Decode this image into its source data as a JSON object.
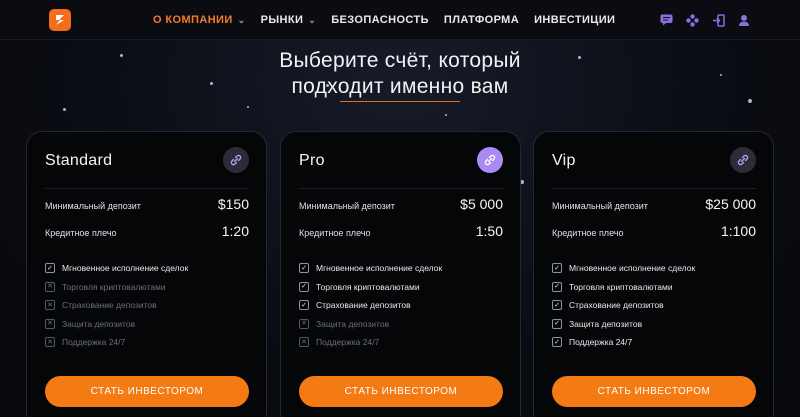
{
  "header": {
    "nav": [
      {
        "label": "О КОМПАНИИ",
        "active": true
      },
      {
        "label": "РЫНКИ",
        "active": false
      },
      {
        "label": "БЕЗОПАСНОСТЬ",
        "active": false
      },
      {
        "label": "ПЛАТФОРМА",
        "active": false
      },
      {
        "label": "ИНВЕСТИЦИИ",
        "active": false
      }
    ],
    "icons": [
      "chat-icon",
      "apps-icon",
      "login-icon",
      "user-icon"
    ]
  },
  "main": {
    "title_line1": "Выберите счёт, который",
    "title_line2": "подходит именно вам"
  },
  "colors": {
    "accent": "#f47a14",
    "background": "#0b0d14",
    "card": "#050608"
  },
  "plans": [
    {
      "name": "Standard",
      "deposit_label": "Минимальный депозит",
      "deposit_value": "$150",
      "leverage_label": "Кредитное плечо",
      "leverage_value": "1:20",
      "features": [
        {
          "label": "Мгновенное исполнение сделок",
          "on": true
        },
        {
          "label": "Торговля криптовалютами",
          "on": false
        },
        {
          "label": "Страхование депозитов",
          "on": false
        },
        {
          "label": "Защита депозитов",
          "on": false
        },
        {
          "label": "Поддержка 24/7",
          "on": false
        }
      ],
      "button": "СТАТЬ ИНВЕСТОРОМ"
    },
    {
      "name": "Pro",
      "deposit_label": "Минимальный депозит",
      "deposit_value": "$5 000",
      "leverage_label": "Кредитное плечо",
      "leverage_value": "1:50",
      "features": [
        {
          "label": "Мгновенное исполнение сделок",
          "on": true
        },
        {
          "label": "Торговля криптовалютами",
          "on": true
        },
        {
          "label": "Страхование депозитов",
          "on": true
        },
        {
          "label": "Защита депозитов",
          "on": false
        },
        {
          "label": "Поддержка 24/7",
          "on": false
        }
      ],
      "button": "СТАТЬ ИНВЕСТОРОМ"
    },
    {
      "name": "Vip",
      "deposit_label": "Минимальный депозит",
      "deposit_value": "$25 000",
      "leverage_label": "Кредитное плечо",
      "leverage_value": "1:100",
      "features": [
        {
          "label": "Мгновенное исполнение сделок",
          "on": true
        },
        {
          "label": "Торговля криптовалютами",
          "on": true
        },
        {
          "label": "Страхование депозитов",
          "on": true
        },
        {
          "label": "Защита депозитов",
          "on": true
        },
        {
          "label": "Поддержка 24/7",
          "on": true
        }
      ],
      "button": "СТАТЬ ИНВЕСТОРОМ"
    }
  ]
}
